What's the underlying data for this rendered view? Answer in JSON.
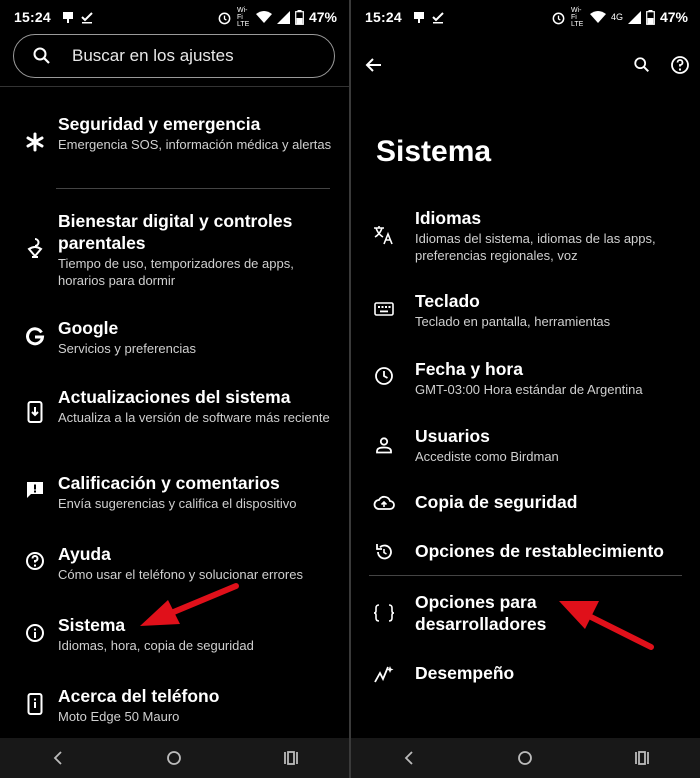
{
  "status_bar": {
    "time": "15:24",
    "battery": "47%",
    "network_left": "Wi-Fi LTE",
    "network_right": "4G"
  },
  "left_screen": {
    "search": {
      "placeholder": "Buscar en los ajustes"
    },
    "items": [
      {
        "title": "Seguridad y emergencia",
        "subtitle": "Emergencia SOS, información médica y alertas",
        "icon": "asterisk-icon"
      },
      {
        "title": "Bienestar digital y controles parentales",
        "subtitle": "Tiempo de uso, temporizadores de apps, horarios para dormir",
        "icon": "wellbeing-icon"
      },
      {
        "title": "Google",
        "subtitle": "Servicios y preferencias",
        "icon": "google-icon"
      },
      {
        "title": "Actualizaciones del sistema",
        "subtitle": "Actualiza a la versión de software más reciente",
        "icon": "system-update-icon"
      },
      {
        "title": "Calificación y comentarios",
        "subtitle": "Envía sugerencias y califica el dispositivo",
        "icon": "feedback-icon"
      },
      {
        "title": "Ayuda",
        "subtitle": "Cómo usar el teléfono y solucionar errores",
        "icon": "help-icon"
      },
      {
        "title": "Sistema",
        "subtitle": "Idiomas, hora, copia de seguridad",
        "icon": "info-icon"
      },
      {
        "title": "Acerca del teléfono",
        "subtitle": "Moto Edge 50 Mauro",
        "icon": "phone-info-icon"
      }
    ]
  },
  "right_screen": {
    "title": "Sistema",
    "items": [
      {
        "title": "Idiomas",
        "subtitle": "Idiomas del sistema, idiomas de las apps, preferencias regionales, voz",
        "icon": "translate-icon"
      },
      {
        "title": "Teclado",
        "subtitle": "Teclado en pantalla, herramientas",
        "icon": "keyboard-icon"
      },
      {
        "title": "Fecha y hora",
        "subtitle": "GMT-03:00 Hora estándar de Argentina",
        "icon": "clock-icon"
      },
      {
        "title": "Usuarios",
        "subtitle": "Accediste como Birdman",
        "icon": "user-icon"
      },
      {
        "title": "Copia de seguridad",
        "subtitle": "",
        "icon": "cloud-backup-icon"
      },
      {
        "title": "Opciones de restablecimiento",
        "subtitle": "",
        "icon": "reset-icon"
      },
      {
        "title": "Opciones para desarrolladores",
        "subtitle": "",
        "icon": "developer-braces-icon"
      },
      {
        "title": "Desempeño",
        "subtitle": "",
        "icon": "performance-icon"
      }
    ]
  },
  "colors": {
    "background": "#000000",
    "arrow": "#e0101a",
    "divider": "#444444"
  }
}
